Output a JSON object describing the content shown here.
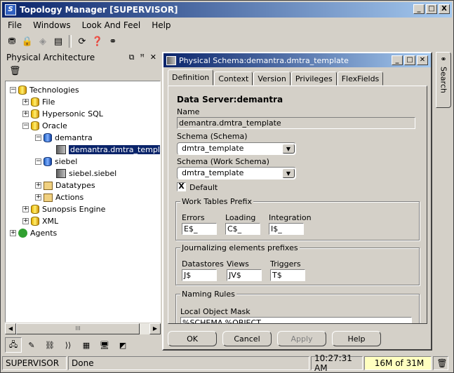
{
  "window": {
    "title": "Topology Manager [SUPERVISOR]",
    "min": "_",
    "max": "□",
    "close": "X"
  },
  "menu": [
    "File",
    "Windows",
    "Look And Feel",
    "Help"
  ],
  "left_pane": {
    "title": "Physical Architecture",
    "tree": {
      "root": "Technologies",
      "items": [
        "File",
        "Hypersonic SQL",
        "Oracle",
        "demantra",
        "demantra.dmtra_template",
        "siebel",
        "siebel.siebel",
        "Datatypes",
        "Actions",
        "Sunopsis Engine",
        "XML"
      ],
      "agents": "Agents"
    },
    "scroll_thumb": "III"
  },
  "frame": {
    "title": "Physical Schema:demantra.dmtra_template",
    "tabs": [
      "Definition",
      "Context",
      "Version",
      "Privileges",
      "FlexFields"
    ],
    "heading": "Data Server:demantra",
    "name_label": "Name",
    "name_value": "demantra.dmtra_template",
    "schema_label": "Schema (Schema)",
    "schema_value": "dmtra_template",
    "work_schema_label": "Schema (Work Schema)",
    "work_schema_value": "dmtra_template",
    "default_label": "Default",
    "default_checked": "X",
    "work_tables": {
      "title": "Work Tables Prefix",
      "errors_label": "Errors",
      "errors_value": "E$_",
      "loading_label": "Loading",
      "loading_value": "C$_",
      "integration_label": "Integration",
      "integration_value": "I$_"
    },
    "journalizing": {
      "title": "Journalizing elements prefixes",
      "datastores_label": "Datastores",
      "datastores_value": "J$",
      "views_label": "Views",
      "views_value": "JV$",
      "triggers_label": "Triggers",
      "triggers_value": "T$"
    },
    "naming": {
      "title": "Naming Rules",
      "local_mask_label": "Local Object Mask",
      "local_mask_value": "%SCHEMA.%OBJECT"
    },
    "buttons": {
      "ok": "OK",
      "cancel": "Cancel",
      "apply": "Apply",
      "help": "Help"
    }
  },
  "search_tab": "Search",
  "status": {
    "user": "SUPERVISOR",
    "message": "Done",
    "time": "10:27:31 AM",
    "memory": "16M of 31M"
  }
}
